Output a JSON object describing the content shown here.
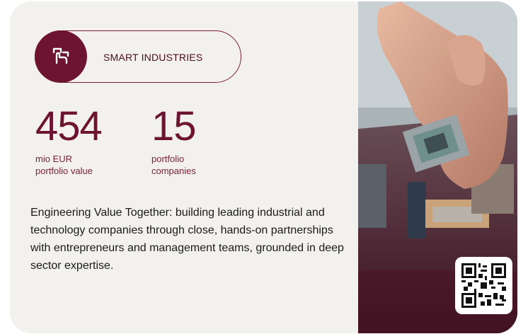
{
  "badge": {
    "label": "SMART INDUSTRIES",
    "icon": "hand-cursor-icon"
  },
  "stats": [
    {
      "value": "454",
      "label_line1": "mio EUR",
      "label_line2": "portfolio value"
    },
    {
      "value": "15",
      "label_line1": "portfolio",
      "label_line2": "companies"
    }
  ],
  "description": "Engineering Value Together: building leading industrial and technology companies through close, hands-on partnerships with entrepreneurs and management teams, grounded in deep sector expertise.",
  "colors": {
    "accent": "#6e1433",
    "card_bg": "#f3f1ed"
  }
}
